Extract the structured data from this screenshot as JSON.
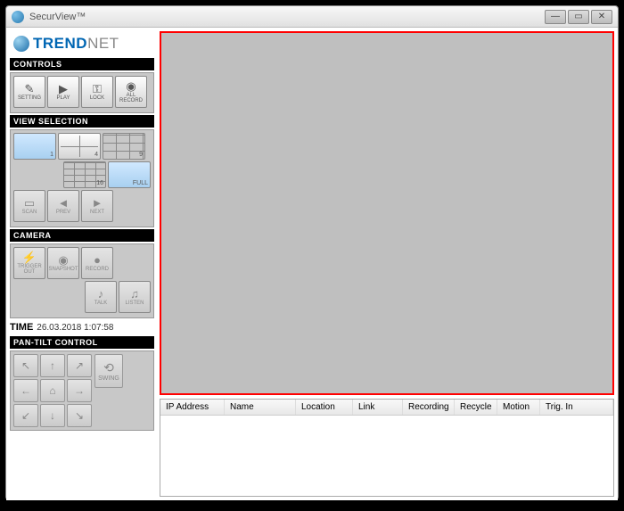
{
  "window": {
    "title": "SecurView™"
  },
  "brand": {
    "name_primary": "TREND",
    "name_secondary": "NET"
  },
  "sections": {
    "controls": {
      "title": "CONTROLS",
      "setting": "SETTING",
      "play": "PLAY",
      "lock": "LOCK",
      "all_record": "ALL RECORD"
    },
    "view": {
      "title": "VIEW SELECTION",
      "v1": "1",
      "v4": "4",
      "v9": "9",
      "v16": "16",
      "full": "FULL",
      "scan": "SCAN",
      "prev": "PREV",
      "next": "NEXT"
    },
    "camera": {
      "title": "CAMERA",
      "trigger": "TRIGGER OUT",
      "snapshot": "SNAPSHOT",
      "record": "RECORD",
      "talk": "TALK",
      "listen": "LISTEN"
    },
    "time": {
      "label": "TIME",
      "value": "26.03.2018 1:07:58"
    },
    "pantilt": {
      "title": "PAN-TILT CONTROL",
      "swing": "SWING"
    }
  },
  "table": {
    "columns": [
      "IP Address",
      "Name",
      "Location",
      "Link",
      "Recording",
      "Recycle",
      "Motion",
      "Trig. In"
    ]
  }
}
